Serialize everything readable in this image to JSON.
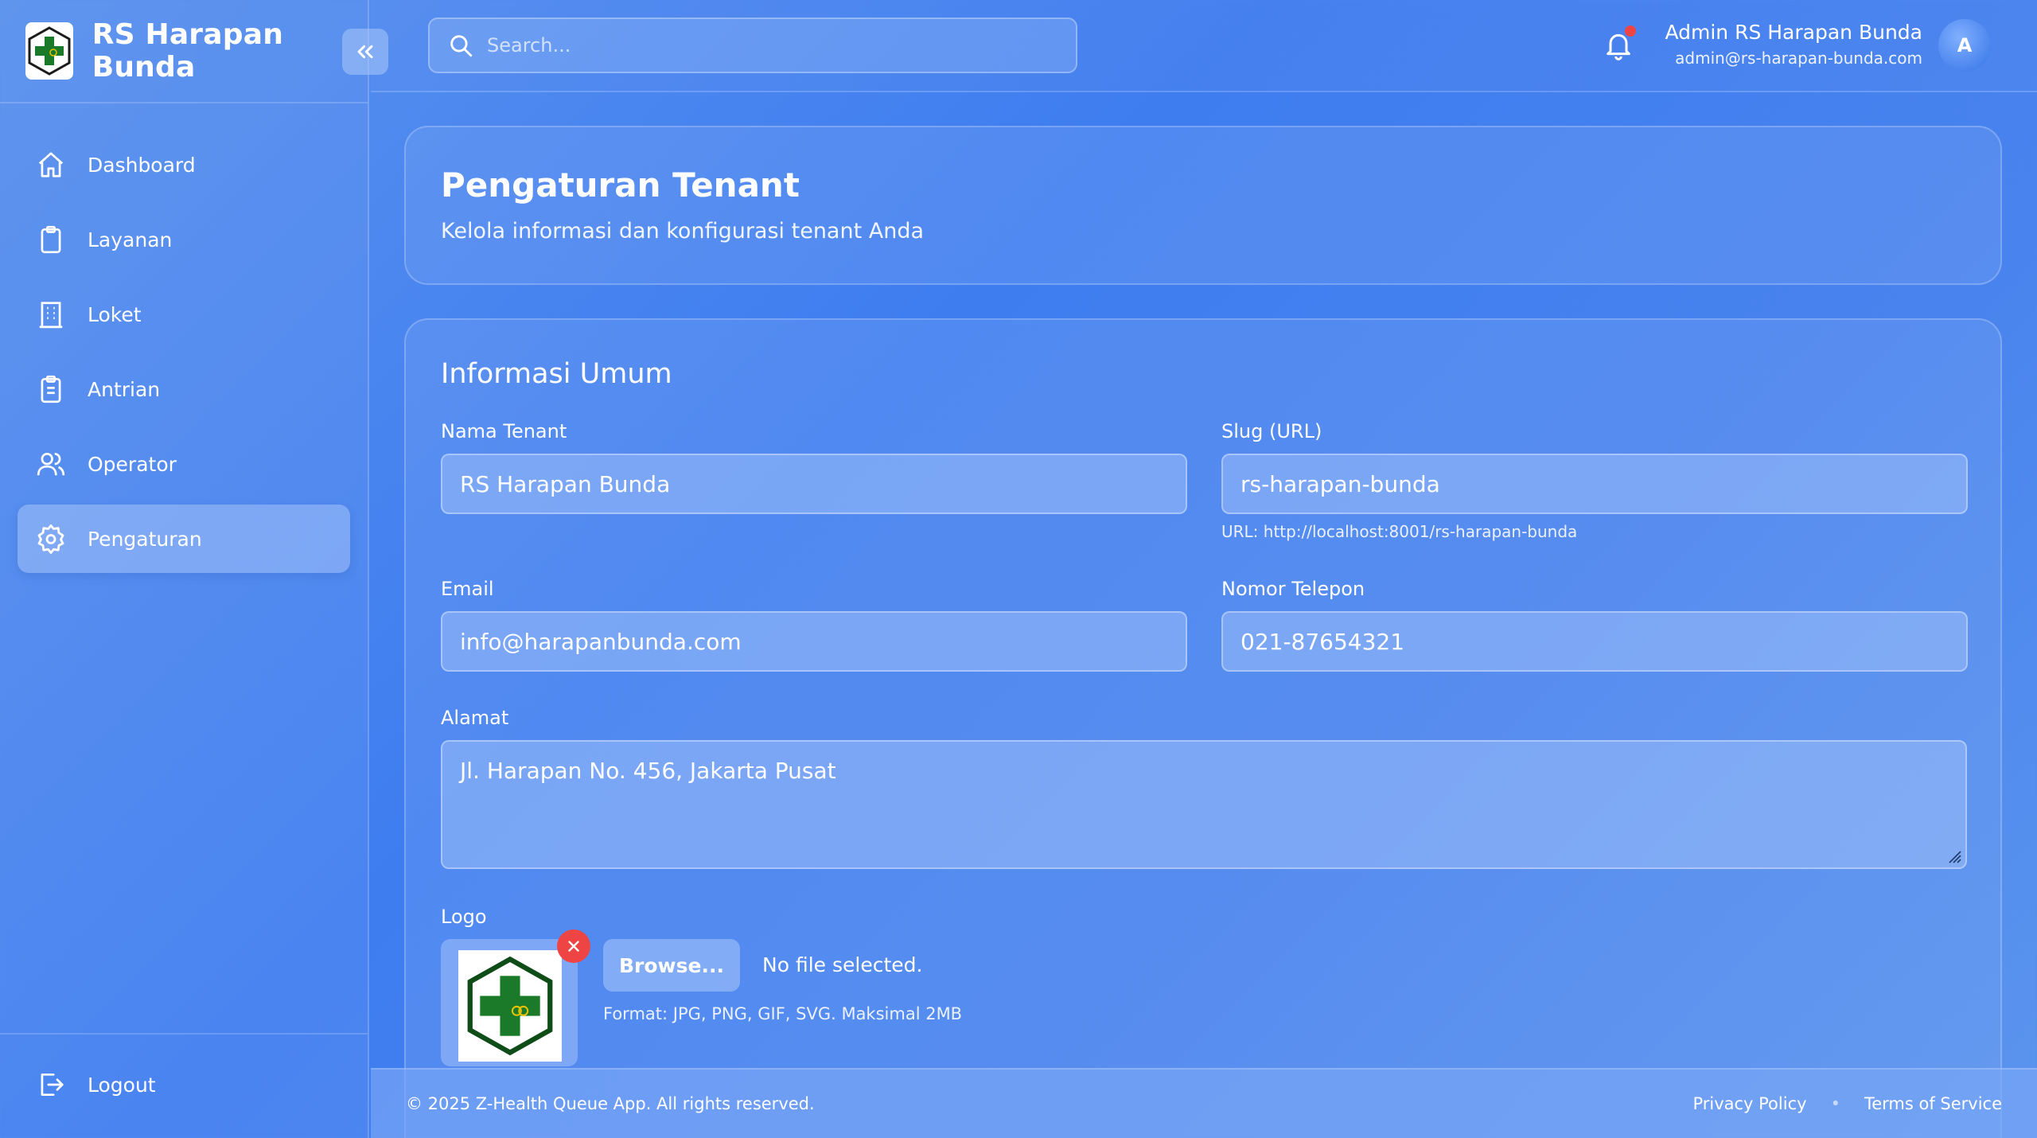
{
  "brand": {
    "name": "RS Harapan Bunda"
  },
  "sidebar": {
    "items": [
      {
        "label": "Dashboard",
        "icon": "home-icon"
      },
      {
        "label": "Layanan",
        "icon": "clipboard-icon"
      },
      {
        "label": "Loket",
        "icon": "building-icon"
      },
      {
        "label": "Antrian",
        "icon": "clipboard-list-icon"
      },
      {
        "label": "Operator",
        "icon": "users-icon"
      },
      {
        "label": "Pengaturan",
        "icon": "gear-icon",
        "active": true
      }
    ],
    "logout": "Logout"
  },
  "topbar": {
    "search_placeholder": "Search...",
    "user_name": "Admin RS Harapan Bunda",
    "user_email": "admin@rs-harapan-bunda.com",
    "avatar_initial": "A"
  },
  "header": {
    "title": "Pengaturan Tenant",
    "subtitle": "Kelola informasi dan konfigurasi tenant Anda"
  },
  "form": {
    "section_title": "Informasi Umum",
    "nama_label": "Nama Tenant",
    "nama_value": "RS Harapan Bunda",
    "slug_label": "Slug (URL)",
    "slug_value": "rs-harapan-bunda",
    "slug_hint": "URL: http://localhost:8001/rs-harapan-bunda",
    "email_label": "Email",
    "email_value": "info@harapanbunda.com",
    "phone_label": "Nomor Telepon",
    "phone_value": "021-87654321",
    "alamat_label": "Alamat",
    "alamat_value": "Jl. Harapan No. 456, Jakarta Pusat",
    "logo_label": "Logo",
    "browse_label": "Browse...",
    "no_file": "No file selected.",
    "format_hint": "Format: JPG, PNG, GIF, SVG. Maksimal 2MB"
  },
  "footer": {
    "copyright": "© 2025 Z-Health Queue App. All rights reserved.",
    "privacy": "Privacy Policy",
    "separator": "•",
    "terms": "Terms of Service"
  },
  "colors": {
    "accent": "#3e7df0",
    "danger": "#ef4444",
    "logo_green": "#1a7a2a"
  }
}
